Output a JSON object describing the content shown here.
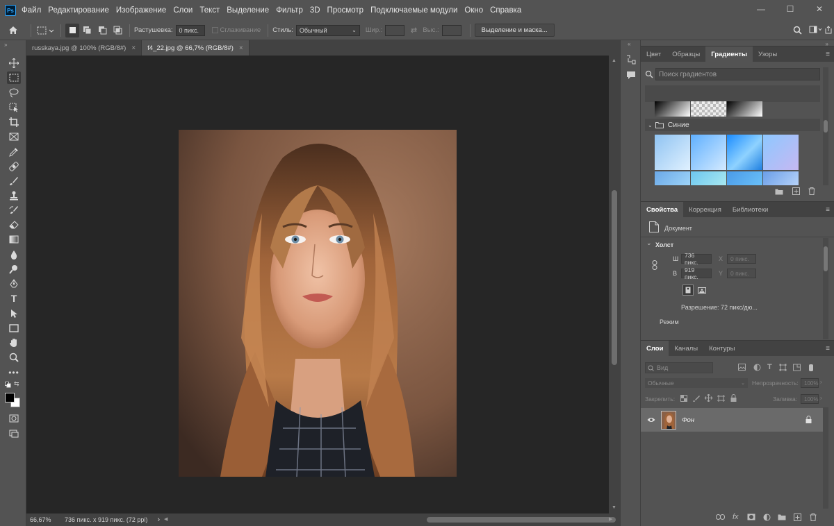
{
  "menu": {
    "logo": "Ps",
    "items": [
      "Файл",
      "Редактирование",
      "Изображение",
      "Слои",
      "Текст",
      "Выделение",
      "Фильтр",
      "3D",
      "Просмотр",
      "Подключаемые модули",
      "Окно",
      "Справка"
    ]
  },
  "window_controls": {
    "minimize": "—",
    "maximize": "☐",
    "close": "✕"
  },
  "options_bar": {
    "feather_label": "Растушевка:",
    "feather_value": "0 пикс.",
    "antialias_label": "Сглаживание",
    "style_label": "Стиль:",
    "style_value": "Обычный",
    "width_label": "Шир.:",
    "height_label": "Выс.:",
    "select_mask_button": "Выделение и маска..."
  },
  "tabs": [
    {
      "label": "russkaya.jpg @ 100% (RGB/8#)",
      "close": "×",
      "active": false
    },
    {
      "label": "f4_22.jpg @ 66,7% (RGB/8#)",
      "close": "×",
      "active": true
    }
  ],
  "status_bar": {
    "zoom": "66,67%",
    "doc_info": "736 пикс. x 919 пикс. (72 ppi)",
    "arrow": "›"
  },
  "gradients_panel": {
    "tabs": [
      "Цвет",
      "Образцы",
      "Градиенты",
      "Узоры"
    ],
    "active_tab": "Градиенты",
    "search_placeholder": "Поиск градиентов",
    "folder_name": "Синие"
  },
  "properties_panel": {
    "tabs": [
      "Свойства",
      "Коррекция",
      "Библиотеки"
    ],
    "active_tab": "Свойства",
    "doc_label": "Документ",
    "section": "Холст",
    "w_label": "Ш",
    "w_value": "736 пикс.",
    "h_label": "В",
    "h_value": "919 пикс.",
    "x_label": "X",
    "x_value": "0 пикс.",
    "y_label": "Y",
    "y_value": "0 пикс.",
    "resolution": "Разрешение: 72 пикс/дю...",
    "mode_label": "Режим"
  },
  "layers_panel": {
    "tabs": [
      "Слои",
      "Каналы",
      "Контуры"
    ],
    "active_tab": "Слои",
    "filter_placeholder": "Вид",
    "blend_mode": "Обычные",
    "opacity_label": "Непрозрачность:",
    "opacity_value": "100%",
    "lock_label": "Закрепить:",
    "fill_label": "Заливка:",
    "fill_value": "100%",
    "layer_name": "Фон"
  }
}
